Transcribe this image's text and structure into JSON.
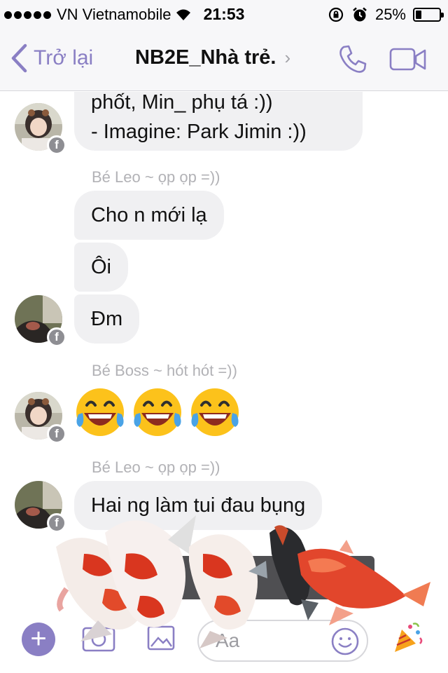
{
  "status_bar": {
    "carrier": "VN Vietnamobile",
    "time": "21:53",
    "battery": "25%",
    "battery_level": 0.25
  },
  "nav": {
    "back_label": "Trở lại",
    "title": "NB2E_Nhà trẻ.",
    "title_chevron": "›"
  },
  "messages": {
    "top_bubble_line1": "phốt, Min_ phụ tá :))",
    "top_bubble_line2": "- Imagine: Park Jimin :))",
    "sender_1": "Bé Leo ~ ọp ọp =))",
    "bubble_cho": "Cho n mới lạ",
    "bubble_oi": "Ôi",
    "bubble_dm": "Đm",
    "sender_2": "Bé Boss ~ hót hót =))",
    "emoji_reaction": "😂😂😂",
    "sender_3": "Bé Leo ~ ọp ọp =))",
    "bubble_hai": "Hai ng làm tui đau bụng"
  },
  "composer": {
    "placeholder": "Aa",
    "add_label": "+"
  },
  "colors": {
    "accent": "#8a7fc4",
    "bubble": "#f0f0f2",
    "sender_text": "#b2b2b6"
  },
  "icons": [
    "wifi-icon",
    "lock-rotation-icon",
    "alarm-icon",
    "battery-icon",
    "back-chevron-icon",
    "phone-icon",
    "video-camera-icon",
    "facebook-badge-icon",
    "plus-icon",
    "camera-icon",
    "gallery-icon",
    "smiley-icon",
    "party-popper-icon"
  ]
}
